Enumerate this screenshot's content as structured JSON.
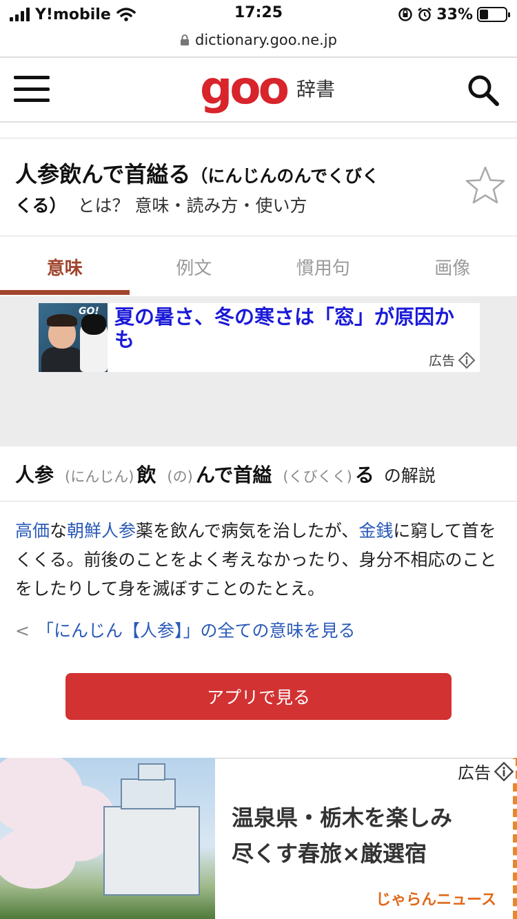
{
  "status": {
    "carrier": "Y!mobile",
    "time": "17:25",
    "battery": "33%",
    "battery_level": 0.33
  },
  "url": "dictionary.goo.ne.jp",
  "header": {
    "logo": "goo",
    "label": "辞書"
  },
  "title": {
    "word": "人参飲んで首縊る",
    "reading_line1": "（にんじんのんでくびく",
    "reading_line2": "くる）",
    "suffix": "とは？ 意味・読み方・使い方"
  },
  "tabs": [
    {
      "label": "意味"
    },
    {
      "label": "例文"
    },
    {
      "label": "慣用句"
    },
    {
      "label": "画像"
    }
  ],
  "ad_top": {
    "title": "夏の暑さ、冬の寒さは「窓」が原因かも",
    "thumb_text": "GO!",
    "label": "広告"
  },
  "explanation": {
    "k1": "人参",
    "r1": "(にんじん)",
    "k2": "飲",
    "r2": "(の)",
    "k3": "んで首縊",
    "r3": "(くびくく)",
    "k4": "る",
    "tail": "の解説",
    "body": {
      "link1": "高価",
      "t1": "な",
      "link2": "朝鮮人参",
      "t2": "薬を飲んで病気を治したが、",
      "link3": "金銭",
      "t3": "に窮して首をくくる。前後のことをよく考えなかったり、身分不相応のことをしたりして身を滅ぼすことのたとえ。"
    },
    "more_chevron": "<",
    "more_link": "「にんじん【人参】」の全ての意味を見る"
  },
  "app_button": "アプリで見る",
  "ad_bottom": {
    "line1": "温泉県・栃木を楽しみ",
    "line2": "尽くす春旅×厳選宿",
    "label": "広告",
    "brand": "じゃらんニュース"
  }
}
